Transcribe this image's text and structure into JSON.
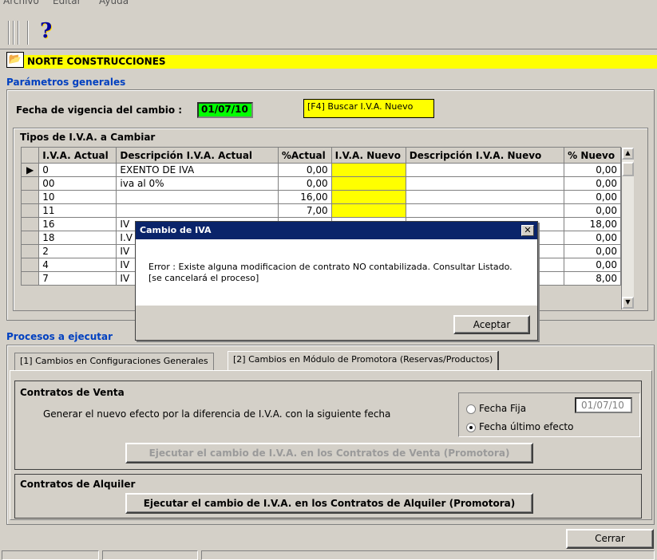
{
  "menu": {
    "items": [
      "Archivo",
      "Editar",
      "Ayuda"
    ]
  },
  "toolbar": {
    "help_icon": "?"
  },
  "company": {
    "name": "NORTE CONSTRUCCIONES"
  },
  "params": {
    "section_title": "Parámetros generales",
    "date_label": "Fecha de vigencia del cambio :",
    "date_value": "01/07/10",
    "search_button": "[F4] Buscar I.V.A. Nuevo"
  },
  "grid": {
    "title": "Tipos de I.V.A. a Cambiar",
    "columns": [
      "I.V.A. Actual",
      "Descripción I.V.A. Actual",
      "%Actual",
      "I.V.A. Nuevo",
      "Descripción I.V.A. Nuevo",
      "% Nuevo"
    ],
    "rows": [
      {
        "iva": "0",
        "desc": "EXENTO DE IVA",
        "pct": "0,00",
        "nuevo": "",
        "desc_nuevo": "",
        "pct_nuevo": "0,00"
      },
      {
        "iva": "00",
        "desc": "iva al 0%",
        "pct": "0,00",
        "nuevo": "",
        "desc_nuevo": "",
        "pct_nuevo": "0,00"
      },
      {
        "iva": "10",
        "desc": "",
        "pct": "16,00",
        "nuevo": "",
        "desc_nuevo": "",
        "pct_nuevo": "0,00"
      },
      {
        "iva": "11",
        "desc": "",
        "pct": "7,00",
        "nuevo": "",
        "desc_nuevo": "",
        "pct_nuevo": "0,00"
      },
      {
        "iva": "16",
        "desc": "IV",
        "pct": "",
        "nuevo": "",
        "desc_nuevo": "",
        "pct_nuevo": "18,00"
      },
      {
        "iva": "18",
        "desc": "I.V",
        "pct": "",
        "nuevo": "",
        "desc_nuevo": "",
        "pct_nuevo": "0,00"
      },
      {
        "iva": "2",
        "desc": "IV",
        "pct": "",
        "nuevo": "",
        "desc_nuevo": "",
        "pct_nuevo": "0,00"
      },
      {
        "iva": "4",
        "desc": "IV",
        "pct": "",
        "nuevo": "",
        "desc_nuevo": "",
        "pct_nuevo": "0,00"
      },
      {
        "iva": "7",
        "desc": "IV",
        "pct": "",
        "nuevo": "",
        "desc_nuevo": "",
        "pct_nuevo": "8,00"
      }
    ]
  },
  "processes": {
    "section_title": "Procesos a ejecutar",
    "tabs": [
      {
        "label": "[1] Cambios en Configuraciones Generales"
      },
      {
        "label": "[2] Cambios en Módulo de Promotora (Reservas/Productos)"
      }
    ],
    "sales": {
      "title": "Contratos de Venta",
      "description": "Generar el nuevo efecto por la diferencia de I.V.A. con la siguiente fecha",
      "radio_fixed": "Fecha Fija",
      "fixed_date": "01/07/10",
      "radio_last": "Fecha último efecto",
      "button": "Ejecutar el cambio de I.V.A. en los Contratos de Venta (Promotora)"
    },
    "rental": {
      "title": "Contratos de Alquiler",
      "button": "Ejecutar el cambio de I.V.A. en los Contratos de Alquiler (Promotora)"
    }
  },
  "close_button": "Cerrar",
  "dialog": {
    "title": "Cambio de IVA",
    "close": "✕",
    "message": "Error : Existe alguna modificacion de contrato NO contabilizada. Consultar Listado. [se cancelará el proceso]",
    "ok": "Aceptar"
  }
}
